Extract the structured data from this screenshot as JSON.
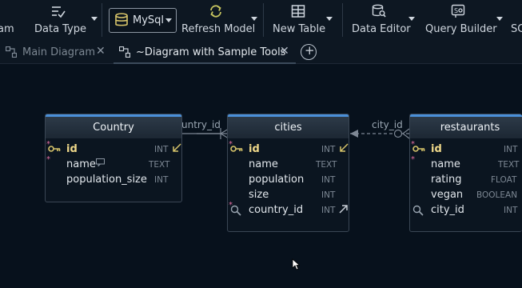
{
  "toolbar": {
    "items": [
      {
        "label": "am",
        "icon": "diagram-icon"
      },
      {
        "label": "Data Type",
        "icon": "data-type-icon"
      },
      {
        "label": "MySql",
        "icon": "database-icon"
      },
      {
        "label": "Refresh Model",
        "icon": "refresh-icon"
      },
      {
        "label": "New Table",
        "icon": "table-icon"
      },
      {
        "label": "Data Editor",
        "icon": "data-editor-icon"
      },
      {
        "label": "Query Builder",
        "icon": "query-builder-icon"
      },
      {
        "label": "SC",
        "icon": "sql-icon"
      }
    ]
  },
  "tabs": [
    {
      "label": "Main Diagram",
      "active": false
    },
    {
      "label": "~Diagram with Sample Tools",
      "active": true
    }
  ],
  "diagram": {
    "links": [
      {
        "label": "untry_id",
        "style": "solid"
      },
      {
        "label": "city_id",
        "style": "dashed"
      }
    ],
    "entities": [
      {
        "name": "Country",
        "columns": [
          {
            "name": "id",
            "type": "INT",
            "pk": true,
            "mandatory": true,
            "ref": "in"
          },
          {
            "name": "name",
            "type": "TEXT",
            "mandatory": true,
            "comment": true
          },
          {
            "name": "population_size",
            "type": "INT"
          }
        ]
      },
      {
        "name": "cities",
        "columns": [
          {
            "name": "id",
            "type": "INT",
            "pk": true,
            "mandatory": true,
            "ref": "in"
          },
          {
            "name": "name",
            "type": "TEXT"
          },
          {
            "name": "population",
            "type": "INT"
          },
          {
            "name": "size",
            "type": "INT"
          },
          {
            "name": "country_id",
            "type": "INT",
            "mandatory": true,
            "fk": true,
            "ref": "out"
          }
        ]
      },
      {
        "name": "restaurants",
        "columns": [
          {
            "name": "id",
            "type": "INT",
            "pk": true,
            "mandatory": true
          },
          {
            "name": "name",
            "type": "TEXT",
            "mandatory": true
          },
          {
            "name": "rating",
            "type": "FLOAT"
          },
          {
            "name": "vegan",
            "type": "BOOLEAN"
          },
          {
            "name": "city_id",
            "type": "INT",
            "fk": true
          }
        ]
      }
    ]
  },
  "colors": {
    "background": "#07111c",
    "toolbar": "#0d1722",
    "icon_accent": "#d8c56a",
    "refresh_icon": "#c9c760",
    "pk_text": "#f0d98a",
    "mandatory_star": "#e06c9f",
    "entity_header_accent": "#4a90d9"
  }
}
